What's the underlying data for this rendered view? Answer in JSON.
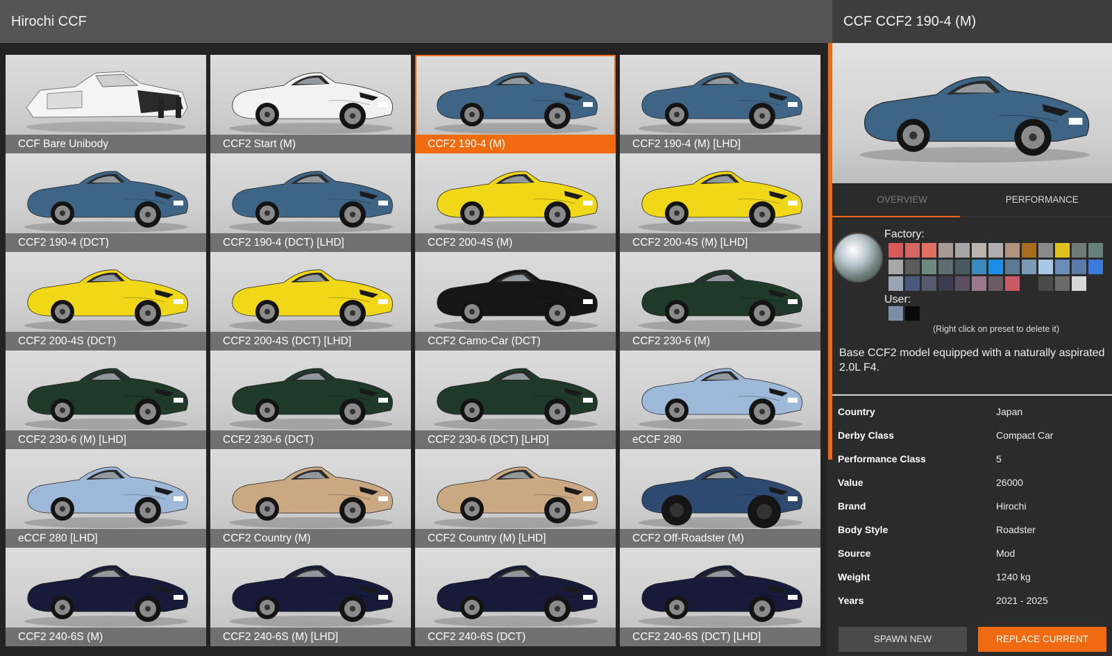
{
  "left_title": "Hirochi CCF",
  "right_title": "CCF CCF2 190-4 (M)",
  "tiles": [
    {
      "label": "CCF Bare Unibody",
      "color": "#e8e8e8",
      "style": "bare"
    },
    {
      "label": "CCF2 Start (M)",
      "color": "#f2f2f2",
      "style": "car"
    },
    {
      "label": "CCF2 190-4 (M)",
      "color": "#3e6585",
      "style": "car",
      "selected": true
    },
    {
      "label": "CCF2 190-4 (M) [LHD]",
      "color": "#3e6585",
      "style": "car"
    },
    {
      "label": "CCF2 190-4 (DCT)",
      "color": "#3e6585",
      "style": "car"
    },
    {
      "label": "CCF2 190-4 (DCT) [LHD]",
      "color": "#3e6585",
      "style": "car"
    },
    {
      "label": "CCF2 200-4S (M)",
      "color": "#f0d818",
      "style": "car"
    },
    {
      "label": "CCF2 200-4S (M) [LHD]",
      "color": "#f0d818",
      "style": "car"
    },
    {
      "label": "CCF2 200-4S (DCT)",
      "color": "#f0d818",
      "style": "car"
    },
    {
      "label": "CCF2 200-4S (DCT) [LHD]",
      "color": "#f0d818",
      "style": "car"
    },
    {
      "label": "CCF2 Camo-Car (DCT)",
      "color": "#161616",
      "style": "car"
    },
    {
      "label": "CCF2 230-6 (M)",
      "color": "#1f3a28",
      "style": "car"
    },
    {
      "label": "CCF2 230-6 (M) [LHD]",
      "color": "#1f3a28",
      "style": "car"
    },
    {
      "label": "CCF2 230-6 (DCT)",
      "color": "#1f3a28",
      "style": "car"
    },
    {
      "label": "CCF2 230-6 (DCT) [LHD]",
      "color": "#1f3a28",
      "style": "car"
    },
    {
      "label": "eCCF 280",
      "color": "#9db8d8",
      "style": "car"
    },
    {
      "label": "eCCF 280 [LHD]",
      "color": "#9db8d8",
      "style": "car"
    },
    {
      "label": "CCF2 Country (M)",
      "color": "#c9a882",
      "style": "car"
    },
    {
      "label": "CCF2 Country (M) [LHD]",
      "color": "#c9a882",
      "style": "car"
    },
    {
      "label": "CCF2 Off-Roadster (M)",
      "color": "#2e4a70",
      "style": "offroad"
    },
    {
      "label": "CCF2 240-6S (M)",
      "color": "#171a38",
      "style": "car"
    },
    {
      "label": "CCF2 240-6S (M) [LHD]",
      "color": "#171a38",
      "style": "car"
    },
    {
      "label": "CCF2 240-6S (DCT)",
      "color": "#171a38",
      "style": "car"
    },
    {
      "label": "CCF2 240-6S (DCT) [LHD]",
      "color": "#171a38",
      "style": "car"
    }
  ],
  "preview_color": "#3e6585",
  "tabs": {
    "overview": "OVERVIEW",
    "performance": "PERFORMANCE"
  },
  "paint": {
    "factory_label": "Factory:",
    "user_label": "User:",
    "hint": "(Right click on preset to delete it)",
    "factory_colors": [
      "#d85a5a",
      "#d46666",
      "#e07060",
      "#a89a94",
      "#a6a6a6",
      "#bcb4ac",
      "#b0aeb0",
      "#b09480",
      "#a86c1c",
      "#8a8a8a",
      "#e0c01c",
      "#6f7a78",
      "#68807a",
      "#a8a8a8",
      "#5c5c5c",
      "#6e8a7e",
      "#5c6e72",
      "#4a5a62",
      "#3a8ac0",
      "#1a8ee8",
      "#5c7a94",
      "#7a9ab4",
      "#a8c8e4",
      "#6c8cb8",
      "#5c7aa8",
      "#3a7ad8",
      "#9aa4b4",
      "#4a5a7c",
      "#565a70",
      "#3a3c52",
      "#5a4e62",
      "#9a7a8a",
      "#6a5a62",
      "#c85a66",
      "#2a2a2a",
      "#4a4a4a",
      "#6a6a6a",
      "#d8d8d8"
    ],
    "user_colors": [
      "#7a8ea8",
      "#0a0a0a"
    ]
  },
  "description": "Base CCF2 model equipped with a naturally aspirated 2.0L F4.",
  "info": [
    {
      "key": "Country",
      "value": "Japan"
    },
    {
      "key": "Derby Class",
      "value": "Compact Car"
    },
    {
      "key": "Performance Class",
      "value": "5"
    },
    {
      "key": "Value",
      "value": "26000"
    },
    {
      "key": "Brand",
      "value": "Hirochi"
    },
    {
      "key": "Body Style",
      "value": "Roadster"
    },
    {
      "key": "Source",
      "value": "Mod"
    },
    {
      "key": "Weight",
      "value": "1240 kg"
    },
    {
      "key": "Years",
      "value": "2021 - 2025"
    }
  ],
  "buttons": {
    "spawn_new": "SPAWN NEW",
    "replace_current": "REPLACE CURRENT"
  }
}
